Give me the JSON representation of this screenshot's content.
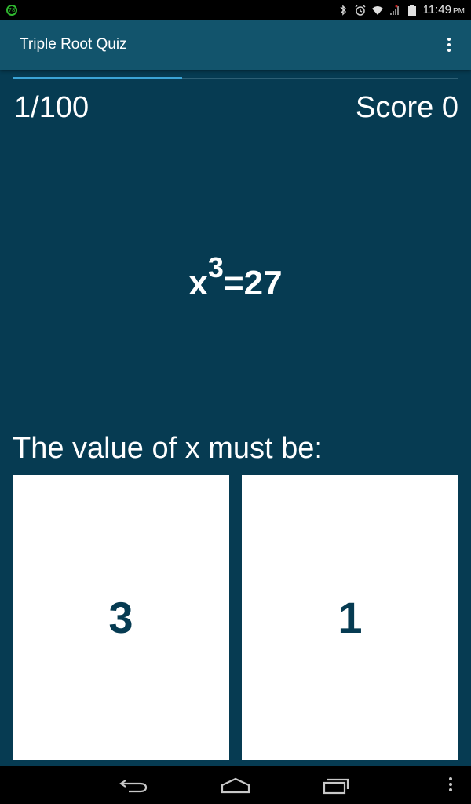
{
  "status_bar": {
    "battery_level": "78",
    "time": "11:49",
    "ampm": "PM",
    "icons": [
      "bluetooth-icon",
      "alarm-icon",
      "wifi-icon",
      "signal-icon",
      "battery-icon"
    ]
  },
  "app_bar": {
    "title": "Triple Root Quiz",
    "overflow_icon": "overflow-menu-icon"
  },
  "quiz": {
    "progress": 0.38,
    "counter": "1/100",
    "score": "Score 0",
    "equation_base": "x",
    "equation_exponent": "3",
    "equation_rhs": "=27",
    "prompt": "The value of x must be:",
    "answers": [
      "3",
      "1"
    ]
  },
  "nav_bar": {
    "icons": [
      "back-icon",
      "home-icon",
      "recent-apps-icon",
      "menu-icon"
    ]
  },
  "colors": {
    "background": "#063b52",
    "app_bar": "#12546c",
    "accent": "#3ba4d6",
    "answer_bg": "#ffffff",
    "answer_text": "#063b52"
  }
}
